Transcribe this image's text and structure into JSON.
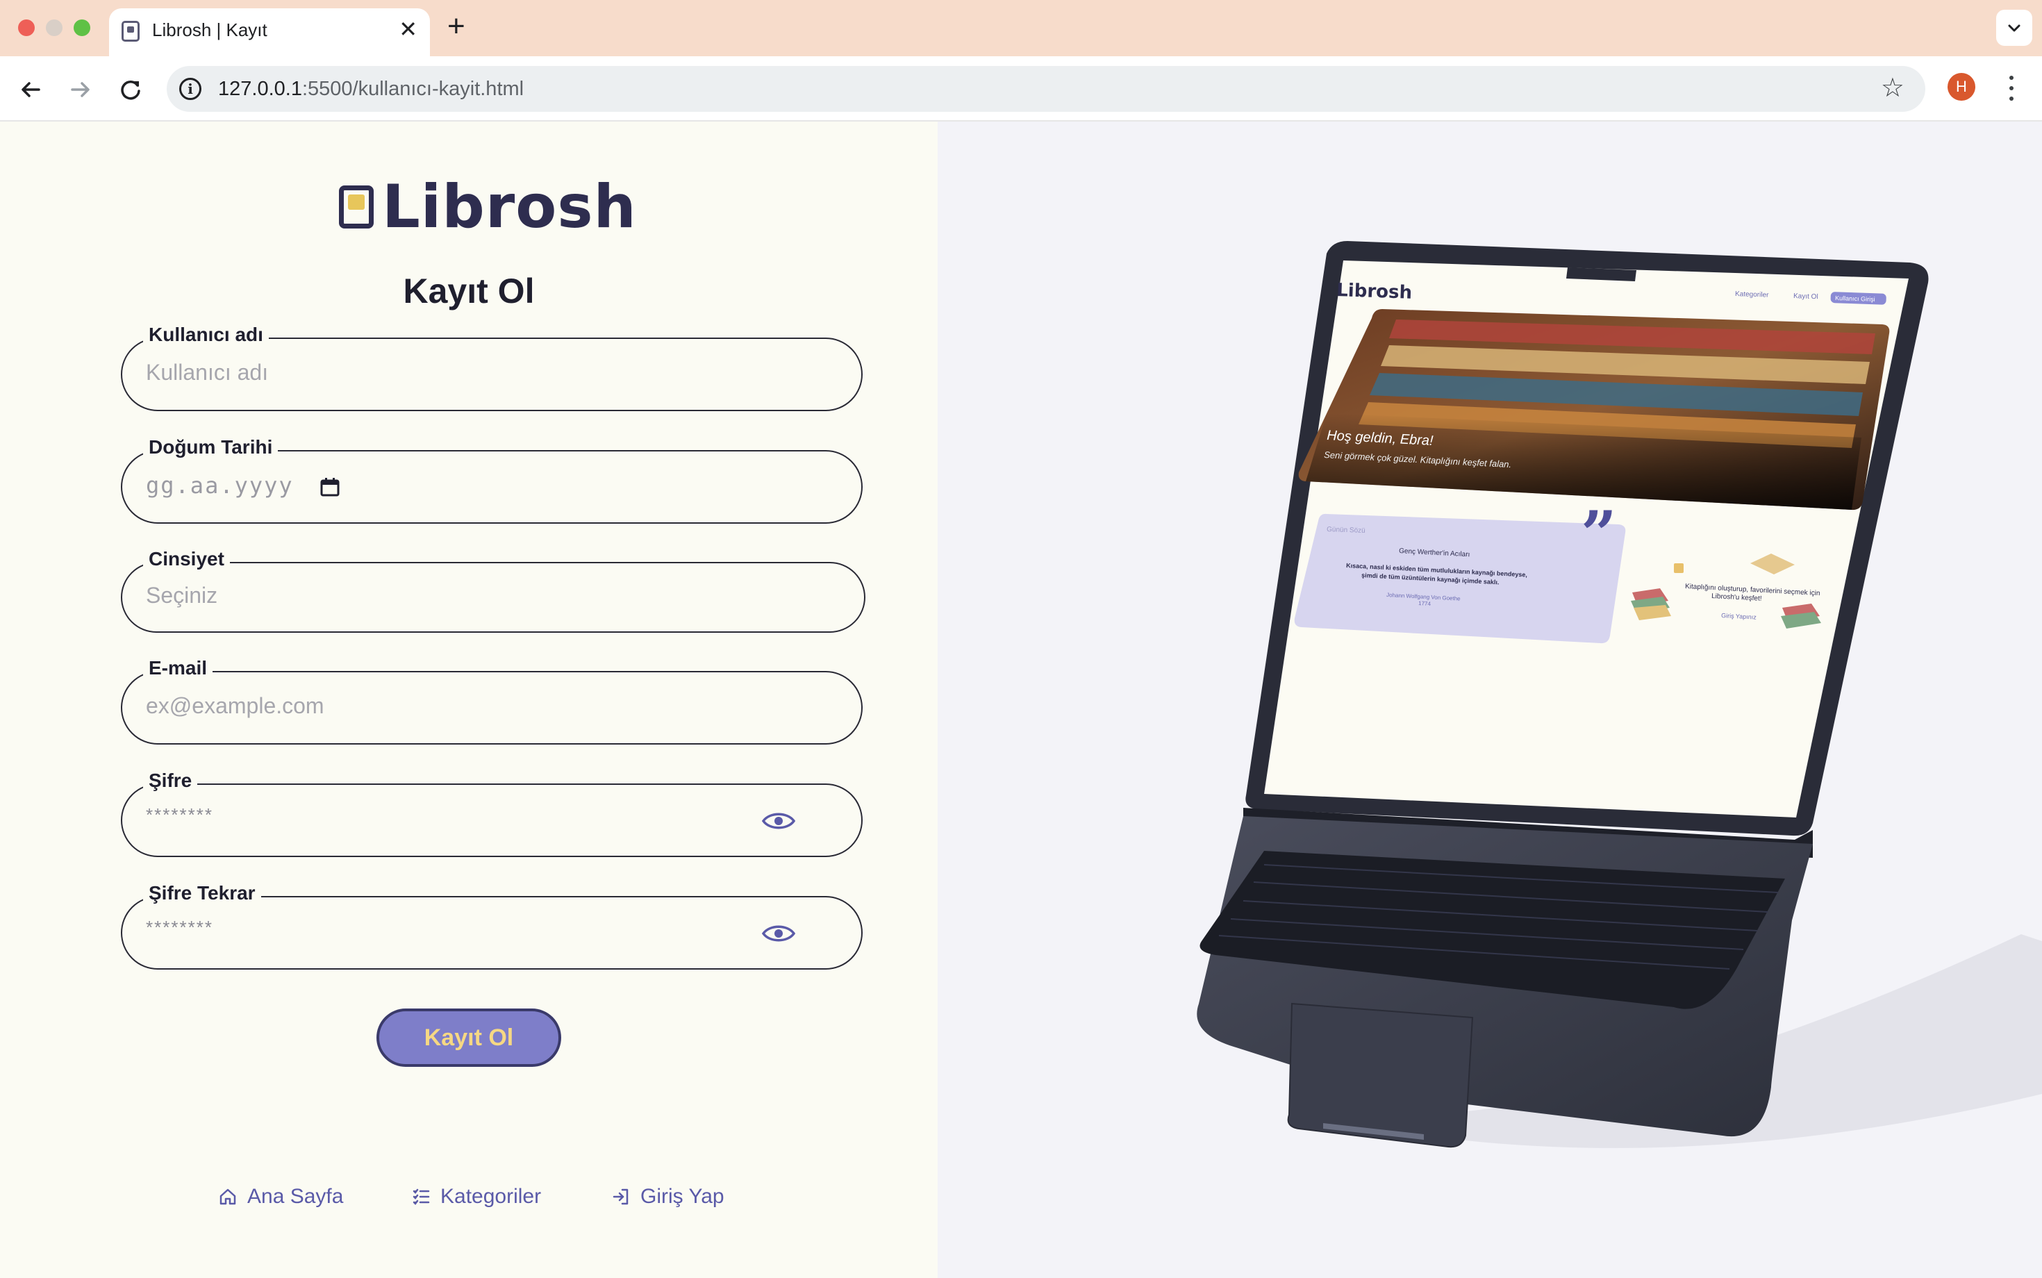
{
  "browser": {
    "tab_title": "Librosh | Kayıt",
    "tab_close": "✕",
    "new_tab": "+",
    "url_host": "127.0.0.1",
    "url_rest": ":5500/kullanıcı-kayit.html",
    "profile_initial": "H"
  },
  "page": {
    "logo_text": "Librosh",
    "form_title": "Kayıt Ol",
    "fields": {
      "username": {
        "label": "Kullanıcı adı",
        "placeholder": "Kullanıcı adı"
      },
      "birthdate": {
        "label": "Doğum Tarihi",
        "placeholder": "gg.aa.yyyy"
      },
      "gender": {
        "label": "Cinsiyet",
        "placeholder": "Seçiniz"
      },
      "email": {
        "label": "E-mail",
        "placeholder": "ex@example.com"
      },
      "password": {
        "label": "Şifre",
        "placeholder": "********"
      },
      "password_repeat": {
        "label": "Şifre Tekrar",
        "placeholder": "********"
      }
    },
    "submit_label": "Kayıt Ol",
    "footer": {
      "home": "Ana Sayfa",
      "categories": "Kategoriler",
      "login": "Giriş Yap"
    },
    "illustration": {
      "logo": "Librosh",
      "nav": [
        "Kategoriler",
        "Kayıt Ol",
        "Kullanıcı Girişi"
      ],
      "hero_title": "Hoş geldin, Ebra!",
      "hero_subtitle": "Seni görmek çok güzel. Kitaplığını keşfet falan.",
      "quote_header": "Günün Sözü",
      "quote_book": "Genç Werther'in Acıları",
      "quote_text_1": "Kısaca, nasıl ki eskiden tüm mutlulukların kaynağı bendeyse,",
      "quote_text_2": "şimdi de tüm üzüntülerin kaynağı içimde saklı.",
      "quote_author": "Johann Wolfgang Von Goethe",
      "quote_year": "1774",
      "promo_text_1": "Kitaplığını oluşturup, favorilerini seçmek için",
      "promo_text_2": "Librosh'u keşfet!",
      "promo_link": "Giriş Yapınız"
    }
  },
  "colors": {
    "tabbar": "#f7dccb",
    "left_bg": "#fbfbf3",
    "right_bg": "#f3f3f8",
    "accent": "#7e7ec9",
    "button_text": "#f6d883",
    "link": "#5a5aa8",
    "logo": "#2e2d4f"
  }
}
